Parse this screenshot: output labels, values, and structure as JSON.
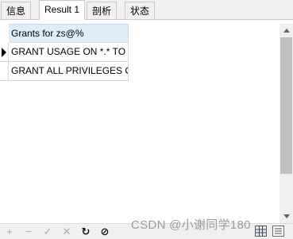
{
  "tabs": [
    {
      "label": "信息"
    },
    {
      "label": "Result 1"
    },
    {
      "label": "剖析"
    },
    {
      "label": "状态"
    }
  ],
  "active_tab": "Result 1",
  "grid": {
    "header": "Grants for zs@%",
    "rows": [
      "GRANT USAGE ON *.* TO",
      "GRANT ALL PRIVILEGES O"
    ]
  },
  "toolbar": {
    "icons": [
      "plus-icon",
      "minus-icon",
      "check-icon",
      "cross-icon",
      "refresh-icon",
      "stop-icon"
    ],
    "add": "+",
    "remove": "−",
    "apply": "✓",
    "discard": "✕",
    "refresh": "↻",
    "stop": "⊘"
  },
  "watermark": "CSDN @小谢同学180",
  "colors": {
    "header_bg": "#ddeefa",
    "tab_bg": "#f0f0f0",
    "scroll_thumb": "#c1c1c1"
  }
}
